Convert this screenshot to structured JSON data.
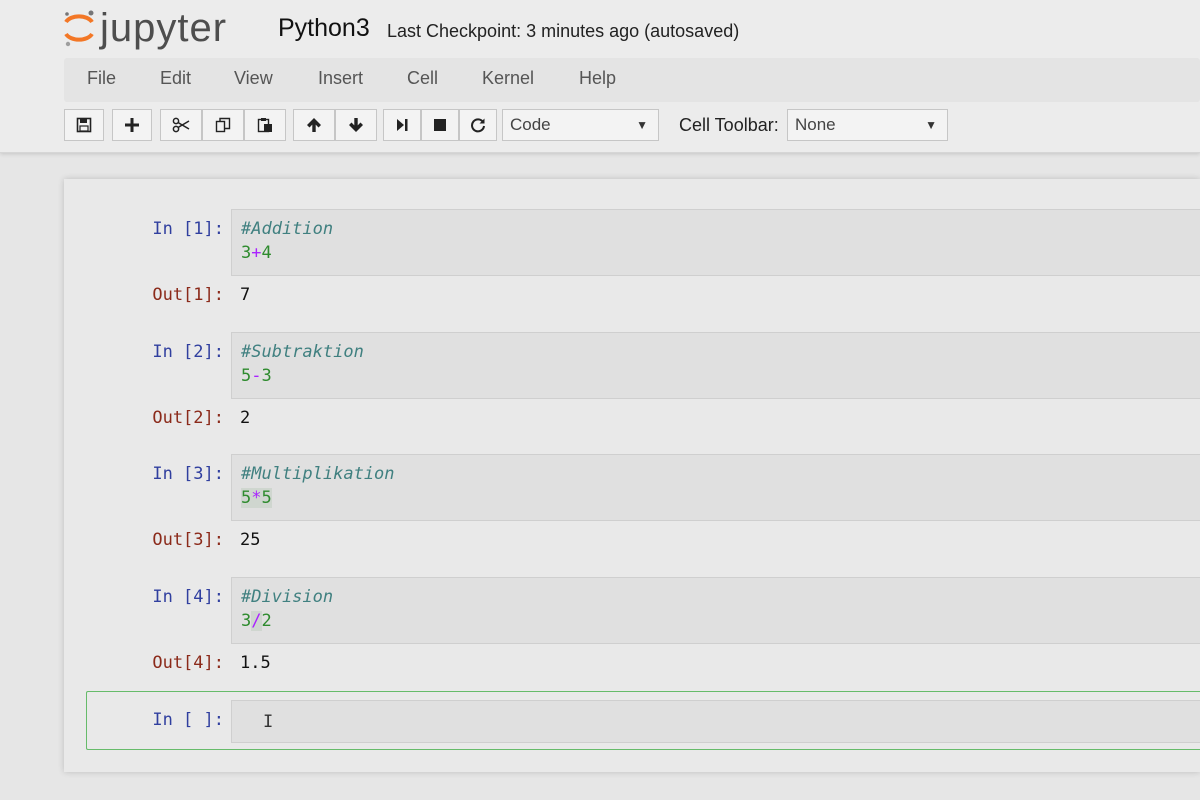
{
  "header": {
    "logo_text": "jupyter",
    "notebook_name": "Python3",
    "checkpoint": "Last Checkpoint: 3 minutes ago (autosaved)"
  },
  "menu": [
    "File",
    "Edit",
    "View",
    "Insert",
    "Cell",
    "Kernel",
    "Help"
  ],
  "toolbar": {
    "buttons": [
      "save-icon",
      "plus-icon",
      "scissors-icon",
      "copy-icon",
      "paste-icon",
      "arrow-up-icon",
      "arrow-down-icon",
      "step-forward-icon",
      "stop-icon",
      "refresh-icon"
    ],
    "cell_type": "Code",
    "cell_toolbar_label": "Cell Toolbar:",
    "cell_toolbar_value": "None"
  },
  "cells": [
    {
      "in_prompt": "In [1]:",
      "comment": "#Addition",
      "code_parts": [
        "3",
        "+",
        "4"
      ],
      "out_prompt": "Out[1]:",
      "output": "7"
    },
    {
      "in_prompt": "In [2]:",
      "comment": "#Subtraktion",
      "code_parts": [
        "5",
        "-",
        "3"
      ],
      "out_prompt": "Out[2]:",
      "output": "2"
    },
    {
      "in_prompt": "In [3]:",
      "comment": "#Multiplikation",
      "code_parts": [
        "5",
        "*",
        "5"
      ],
      "out_prompt": "Out[3]:",
      "output": "25"
    },
    {
      "in_prompt": "In [4]:",
      "comment": "#Division",
      "code_parts": [
        "3",
        "/",
        "2"
      ],
      "out_prompt": "Out[4]:",
      "output": "1.5"
    }
  ],
  "empty_cell": {
    "in_prompt": "In [ ]:"
  },
  "colors": {
    "active_border": "#66bb6a",
    "in_prompt": "#303f9f",
    "out_prompt": "#8b2a1a"
  }
}
